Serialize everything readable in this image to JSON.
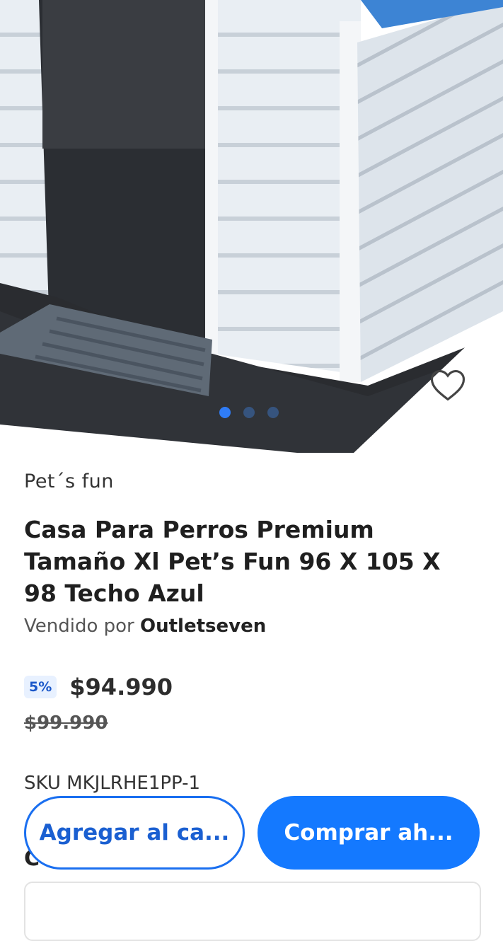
{
  "product": {
    "brand": "Pet´s fun",
    "title": "Casa Para Perros Premium Tamaño Xl Pet’s Fun 96 X 105 X 98 Techo Azul",
    "seller_prefix": "Vendido por",
    "seller_name": "Outletseven",
    "discount_badge": "5%",
    "price": "$94.990",
    "old_price": "$99.990",
    "sku": "SKU MKJLRHE1PP-1",
    "partial_label": "C"
  },
  "carousel": {
    "image_icon": "dog-house-photo",
    "favorite_icon": "heart-outline-icon",
    "dots": 3,
    "active_index": 0
  },
  "actions": {
    "add_to_cart_label": "Agregar al ca...",
    "buy_now_label": "Comprar ah..."
  },
  "colors": {
    "primary": "#1479ff",
    "discount_text": "#1a57c9",
    "discount_bg": "#e8f1ff"
  }
}
